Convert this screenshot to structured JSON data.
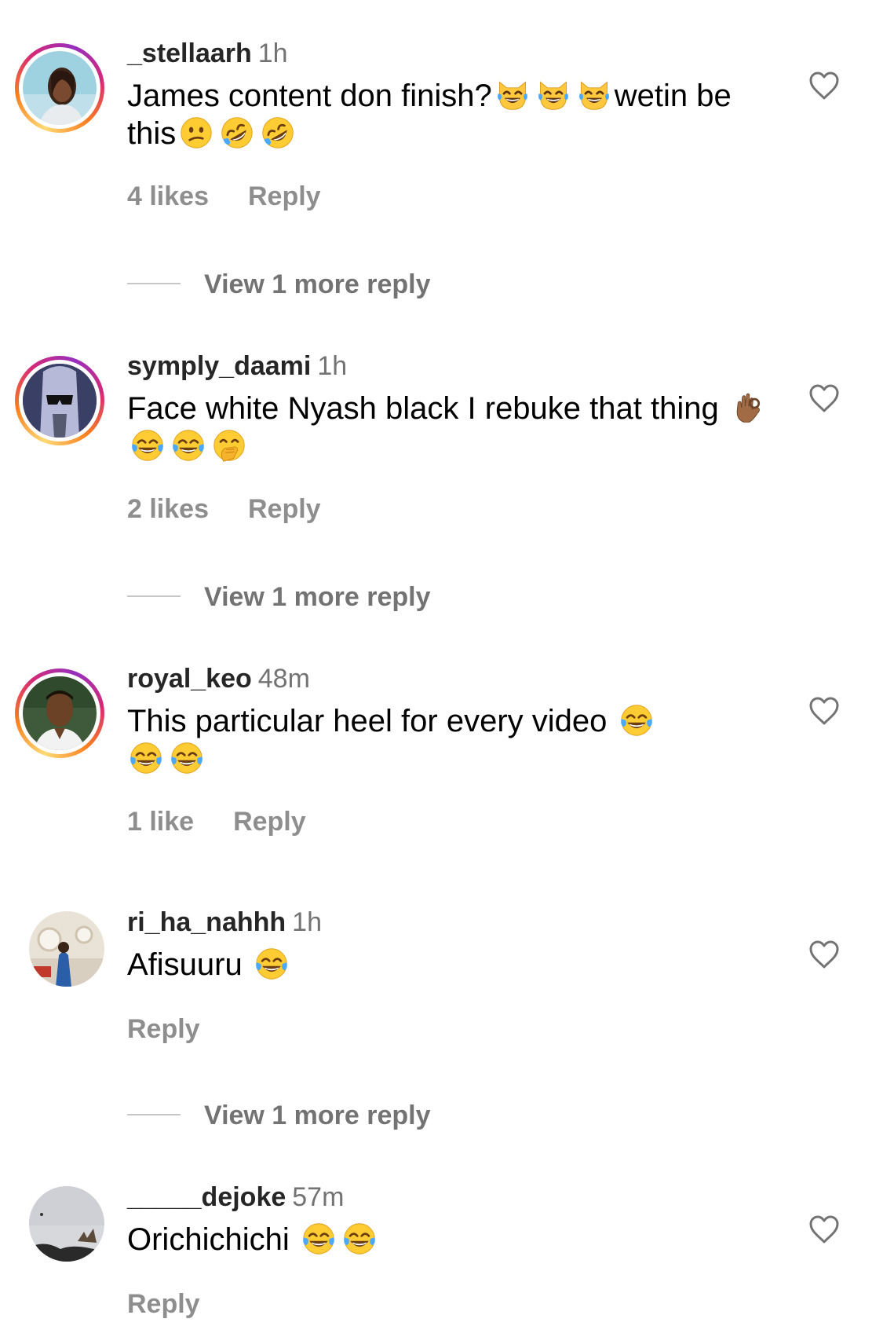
{
  "comments": [
    {
      "username": "_stellaarh",
      "time": "1h",
      "text_before": "James content don finish?",
      "text_after_emoji": "wetin be this",
      "likes": "4 likes",
      "reply_label": "Reply",
      "view_more": "View 1 more reply",
      "emojis": [
        "cat-tears-of-joy",
        "cat-tears-of-joy",
        "cat-tears-of-joy",
        "confused-face",
        "rofl",
        "rofl"
      ]
    },
    {
      "username": "symply_daami",
      "time": "1h",
      "text": "Face white Nyash black I rebuke that thing",
      "likes": "2 likes",
      "reply_label": "Reply",
      "view_more": "View 1 more reply",
      "emojis": [
        "ok-hand-medium-dark",
        "tears-of-joy",
        "tears-of-joy",
        "face-with-hand-over-mouth"
      ]
    },
    {
      "username": "royal_keo",
      "time": "48m",
      "text": "This particular heel for every video",
      "likes": "1 like",
      "reply_label": "Reply",
      "emojis": [
        "tears-of-joy",
        "tears-of-joy",
        "tears-of-joy"
      ]
    },
    {
      "username": "ri_ha_nahhh",
      "time": "1h",
      "text": "Afisuuru",
      "reply_label": "Reply",
      "view_more": "View 1 more reply",
      "emojis": [
        "tears-of-joy"
      ]
    },
    {
      "username": "_____dejoke",
      "time": "57m",
      "text": "Orichichichi",
      "reply_label": "Reply",
      "emojis": [
        "tears-of-joy",
        "tears-of-joy"
      ]
    }
  ],
  "icons": {
    "like": "heart-outline-icon"
  },
  "colors": {
    "username": "#262626",
    "secondary": "#737373",
    "meta": "#8e8e8e",
    "story_ring_start": "#feda75",
    "story_ring_mid": "#d62976",
    "story_ring_end": "#962fbf"
  }
}
